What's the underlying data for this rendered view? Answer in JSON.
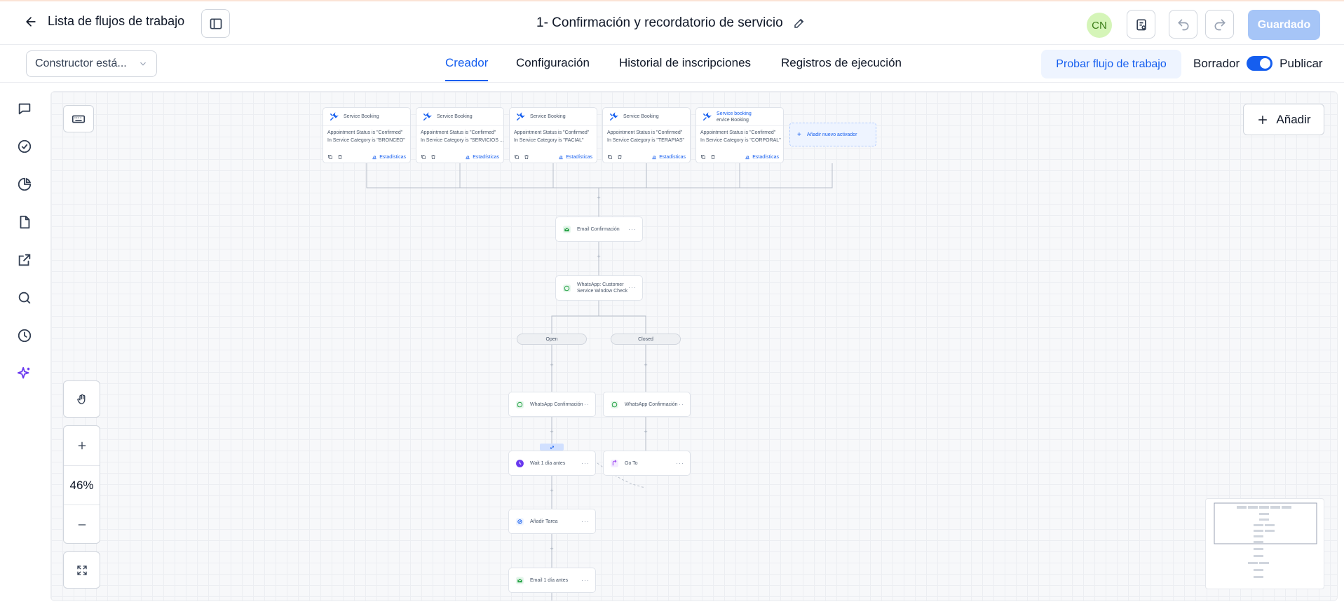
{
  "header": {
    "back_label": "Lista de flujos de trabajo",
    "title": "1- Confirmación y recordatorio de servicio",
    "avatar_initials": "CN",
    "saved_label": "Guardado"
  },
  "subbar": {
    "builder_select_value": "Constructor está...",
    "tabs": [
      {
        "label": "Creador",
        "active": true
      },
      {
        "label": "Configuración",
        "active": false
      },
      {
        "label": "Historial de inscripciones",
        "active": false
      },
      {
        "label": "Registros de ejecución",
        "active": false
      }
    ],
    "test_label": "Probar flujo de trabajo",
    "draft_label": "Borrador",
    "publish_label": "Publicar"
  },
  "canvas": {
    "add_label": "Añadir",
    "zoom": "46%",
    "triggers": [
      {
        "title": "Service Booking",
        "line1": "Appointment Status is \"Confirmed\"",
        "line2": "In Service Category is \"BRONCEO\"",
        "stats": "Estadísticas"
      },
      {
        "title": "Service Booking",
        "line1": "Appointment Status is \"Confirmed\"",
        "line2": "In Service Category is \"SERVICIOS ...",
        "stats": "Estadísticas"
      },
      {
        "title": "Service Booking",
        "line1": "Appointment Status is \"Confirmed\"",
        "line2": "In Service Category is \"FACIAL\"",
        "stats": "Estadísticas"
      },
      {
        "title": "Service Booking",
        "line1": "Appointment Status is \"Confirmed\"",
        "line2": "In Service Category is \"TERAPIAS\"",
        "stats": "Estadísticas"
      },
      {
        "title": "Service booking",
        "subtitle": "ervice Booking",
        "line1": "Appointment Status is \"Confirmed\"",
        "line2": "In Service Category is \"CORPORAL\"",
        "stats": "Estadísticas"
      }
    ],
    "new_trigger_label": "Añadir nuevo activador",
    "nodes": {
      "email_confirm": "Email Confirmación",
      "wa_check": "WhatsApp: Customer Service Window Check",
      "open": "Open",
      "closed": "Closed",
      "wa_confirm_left": "WhatsApp Confirmación",
      "wa_confirm_right": "WhatsApp Confirmación",
      "wait": "Wait 1 día antes",
      "goto": "Go To",
      "task": "Añadir Tarea",
      "email_reminder": "Email 1 día antes"
    }
  },
  "colors": {
    "accent": "#155eef",
    "saved_button": "#a6c5f7",
    "avatar_bg": "#d5f5b8",
    "whatsapp": "#25a244",
    "wait_purple": "#6938ef"
  }
}
